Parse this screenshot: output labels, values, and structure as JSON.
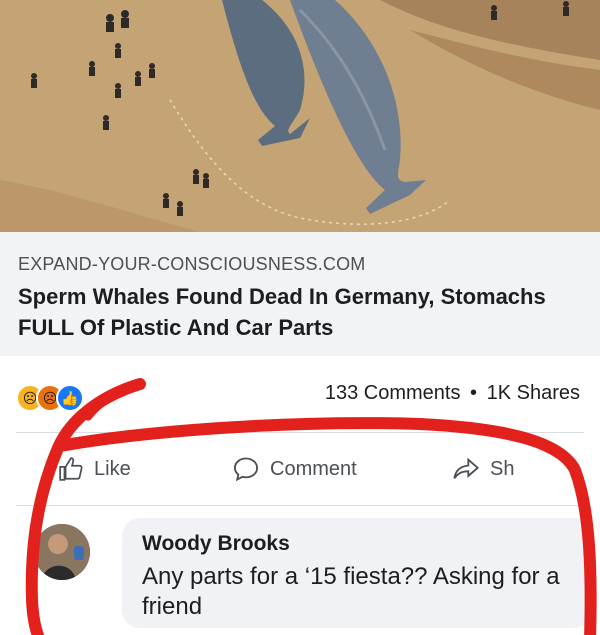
{
  "link_preview": {
    "domain": "EXPAND-YOUR-CONSCIOUSNESS.COM",
    "headline": "Sperm Whales Found Dead In Germany, Stomachs FULL Of Plastic And Car Parts"
  },
  "engagement": {
    "reactions": [
      "sad-reaction-icon",
      "angry-reaction-icon",
      "like-reaction-icon"
    ],
    "comments": "133 Comments",
    "separator": "•",
    "shares": "1K Shares"
  },
  "actions": {
    "like": "Like",
    "comment": "Comment",
    "share": "Sh"
  },
  "comment": {
    "author": "Woody Brooks",
    "text": "Any parts for a ‘15 fiesta?? Asking for a friend"
  },
  "colors": {
    "sand": "#c9a878",
    "whale": "#5d6d80",
    "scribble": "#e3211c",
    "facebook_blue": "#1877f2"
  }
}
